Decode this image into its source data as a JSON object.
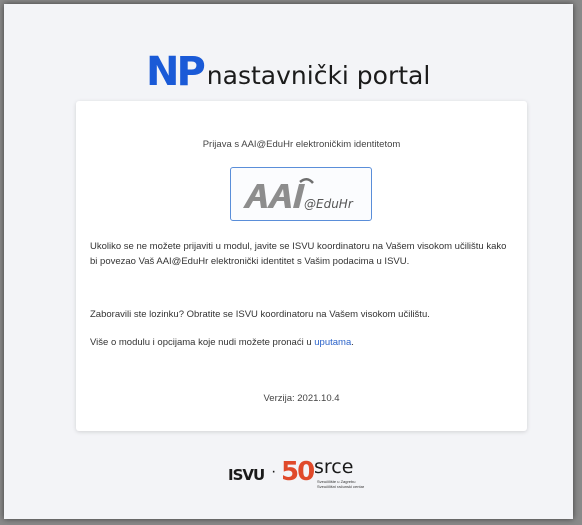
{
  "header": {
    "logo_mark": "NP",
    "title": "nastavnički portal"
  },
  "login": {
    "heading": "Prijava s AAI@EduHr elektroničkim identitetom",
    "aai_button_label": "@EduHr",
    "aai_button_mark": "AAI",
    "info_text": "Ukoliko se ne možete prijaviti u modul, javite se ISVU koordinatoru na Vašem visokom učilištu kako bi povezao Vaš AAI@EduHr elektronički identitet s Vašim podacima u ISVU.",
    "password_text": "Zaboravili ste lozinku? Obratite se ISVU koordinatoru na Vašem visokom učilištu.",
    "more_text_prefix": "Više o modulu i opcijama koje nudi možete pronaći u",
    "more_link_text": "uputama",
    "more_text_suffix": ".",
    "version": "Verzija: 2021.10.4"
  },
  "footer": {
    "isvu_logo": "ISVU",
    "separator": "·",
    "anniversary": "50",
    "srce_logo": "srce",
    "srce_line1": "Sveučilište u Zagrebu",
    "srce_line2": "Sveučilišni računski centar"
  },
  "colors": {
    "brand_blue": "#1a5ad7",
    "link": "#2a62c9",
    "srce_red": "#e04a2b",
    "background": "#f3f4f7"
  }
}
